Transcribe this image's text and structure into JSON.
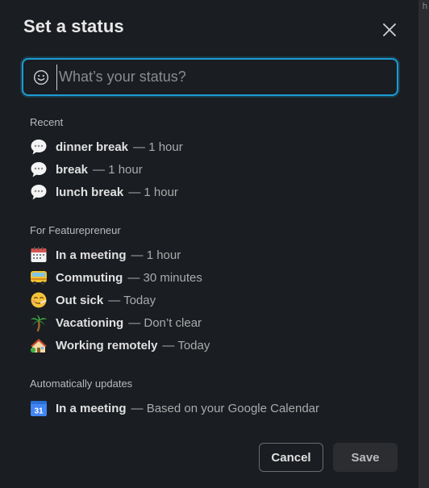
{
  "dialog": {
    "title": "Set a status",
    "close_icon": "close-icon"
  },
  "search": {
    "placeholder": "What’s your status?",
    "value": "",
    "icon": "smiley-icon"
  },
  "sections": {
    "recent": {
      "title": "Recent",
      "items": [
        {
          "label": "dinner break",
          "duration": "— 1 hour",
          "icon": "speech-bubble-icon"
        },
        {
          "label": "break",
          "duration": "— 1 hour",
          "icon": "speech-bubble-icon"
        },
        {
          "label": "lunch break",
          "duration": "— 1 hour",
          "icon": "speech-bubble-icon"
        }
      ]
    },
    "workspace": {
      "title": "For Featurepreneur",
      "items": [
        {
          "label": "In a meeting",
          "duration": "— 1 hour",
          "icon": "calendar-icon"
        },
        {
          "label": "Commuting",
          "duration": "— 30 minutes",
          "icon": "bus-icon"
        },
        {
          "label": "Out sick",
          "duration": "— Today",
          "icon": "sick-face-icon"
        },
        {
          "label": "Vacationing",
          "duration": "— Don’t clear",
          "icon": "palm-tree-icon"
        },
        {
          "label": "Working remotely",
          "duration": "— Today",
          "icon": "house-icon"
        }
      ]
    },
    "auto": {
      "title": "Automatically updates",
      "items": [
        {
          "label": "In a meeting",
          "duration": "— Based on your Google Calendar",
          "icon": "google-calendar-icon",
          "icon_text": "31"
        }
      ]
    }
  },
  "buttons": {
    "cancel": "Cancel",
    "save": "Save"
  },
  "background": {
    "glyph": "h"
  },
  "colors": {
    "accent": "#1d9bd1",
    "background": "#1a1d21"
  }
}
